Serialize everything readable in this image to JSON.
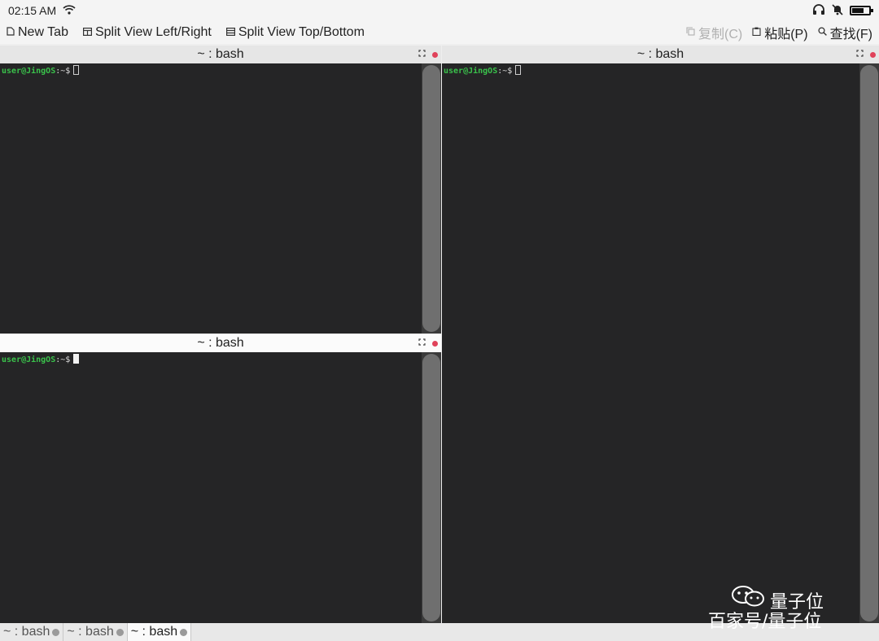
{
  "status_bar": {
    "time": "02:15 AM",
    "battery_level": 0.7
  },
  "toolbar": {
    "new_tab": "New Tab",
    "split_lr": "Split View Left/Right",
    "split_tb": "Split View Top/Bottom",
    "copy": "复制(C)",
    "paste": "粘贴(P)",
    "find": "查找(F)"
  },
  "panes": [
    {
      "title": "~ : bash",
      "prompt_user": "user@JingOS",
      "prompt_path": ":~$"
    },
    {
      "title": "~ : bash",
      "prompt_user": "user@JingOS",
      "prompt_path": ":~$"
    },
    {
      "title": "~ : bash",
      "prompt_user": "user@JingOS",
      "prompt_path": ":~$"
    }
  ],
  "tabs": [
    "~ : bash",
    "~ : bash",
    "~ : bash"
  ],
  "watermark": {
    "line1": "量子位",
    "line2": "百家号/量子位"
  }
}
